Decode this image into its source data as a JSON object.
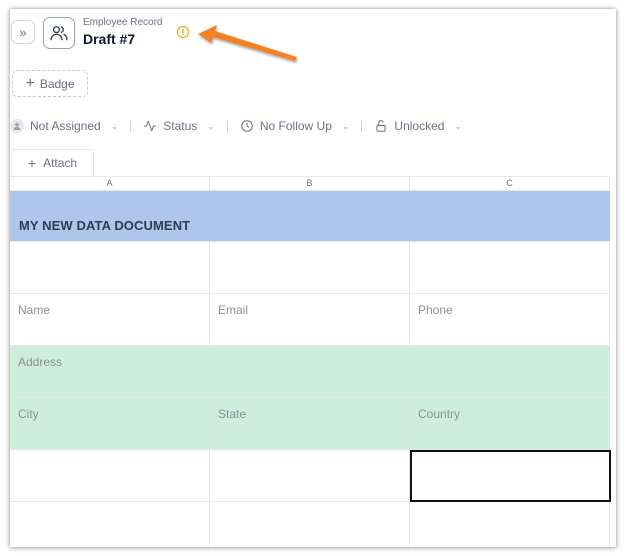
{
  "header": {
    "record_type": "Employee Record",
    "title": "Draft #7",
    "expand_glyph": "»",
    "record_icon": "users-icon",
    "warning_icon": "alert-circle-icon",
    "annotation": "orange-arrow"
  },
  "badge": {
    "label": "Badge",
    "icon": "plus-icon"
  },
  "meta": {
    "assignee": "Not Assigned",
    "status": "Status",
    "follow_up": "No Follow Up",
    "lock": "Unlocked"
  },
  "tabs": {
    "attach": "Attach"
  },
  "sheet": {
    "columns": [
      "A",
      "B",
      "C"
    ],
    "title": "MY NEW DATA DOCUMENT",
    "rows": {
      "contact": [
        "Name",
        "Email",
        "Phone"
      ],
      "address": "Address",
      "location": [
        "City",
        "State",
        "Country"
      ]
    }
  },
  "colors": {
    "title_band": "#aec6ec",
    "address_band": "#cdeedd",
    "warning": "#e5a50a",
    "annotation_arrow": "#f58220"
  }
}
